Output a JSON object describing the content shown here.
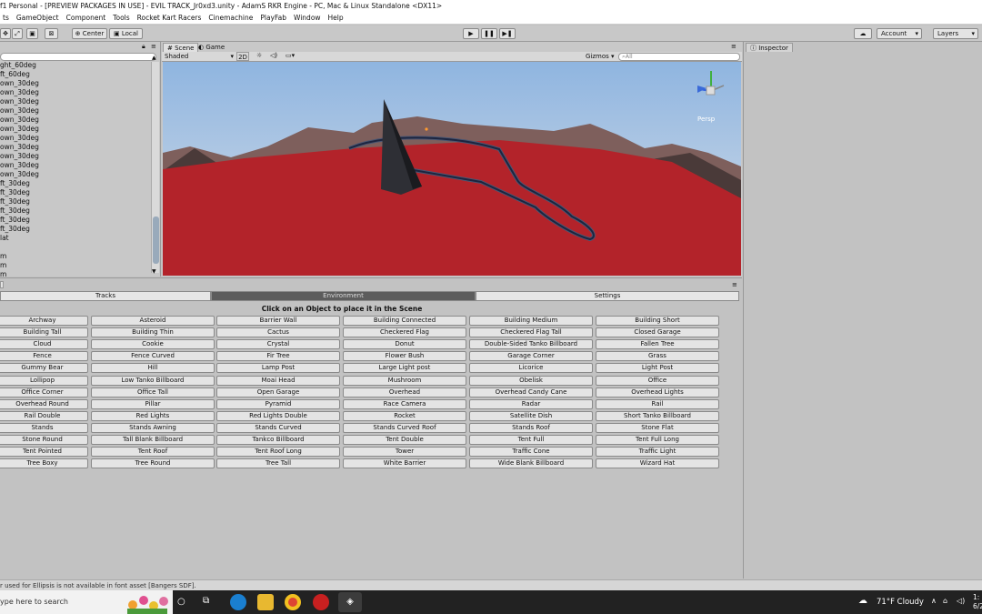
{
  "window_title": "f1 Personal - [PREVIEW PACKAGES IN USE] - EVIL TRACK_Jr0xd3.unity - AdamS RKR Engine - PC, Mac & Linux Standalone <DX11>",
  "menu": [
    "ts",
    "GameObject",
    "Component",
    "Tools",
    "Rocket Kart Racers",
    "Cinemachine",
    "PlayFab",
    "Window",
    "Help"
  ],
  "toolbar": {
    "center": "Center",
    "local": "Local",
    "account": "Account",
    "layers": "Layers"
  },
  "hierarchy_items": [
    "ght_60deg",
    "ft_60deg",
    "own_30deg",
    "own_30deg",
    "own_30deg",
    "own_30deg",
    "own_30deg",
    "own_30deg",
    "own_30deg",
    "own_30deg",
    "own_30deg",
    "own_30deg",
    "own_30deg",
    "ft_30deg",
    "ft_30deg",
    "ft_30deg",
    "ft_30deg",
    "ft_30deg",
    "ft_30deg",
    "lat",
    "",
    "m",
    "m",
    "m"
  ],
  "scene": {
    "tab_scene": "Scene",
    "tab_game": "Game",
    "shaded": "Shaded",
    "twod": "2D",
    "gizmos": "Gizmos",
    "search_placeholder": "All",
    "persp": "Persp"
  },
  "inspector_title": "Inspector",
  "bottom_tabs": [
    "Tracks",
    "Environment",
    "Settings"
  ],
  "hint": "Click on an Object to place it in the Scene",
  "objects": [
    "Archway",
    "Asteroid",
    "Barrier Wall",
    "Building Connected",
    "Building Medium",
    "Building Short",
    "Building Tall",
    "Building Thin",
    "Cactus",
    "Checkered Flag",
    "Checkered Flag Tall",
    "Closed Garage",
    "Cloud",
    "Cookie",
    "Crystal",
    "Donut",
    "Double-Sided Tanko Billboard",
    "Fallen Tree",
    "Fence",
    "Fence Curved",
    "Fir Tree",
    "Flower Bush",
    "Garage Corner",
    "Grass",
    "Gummy Bear",
    "Hill",
    "Lamp Post",
    "Large Light post",
    "Licorice",
    "Light Post",
    "Lollipop",
    "Low Tanko Billboard",
    "Moai Head",
    "Mushroom",
    "Obelisk",
    "Office",
    "Office Corner",
    "Office Tall",
    "Open Garage",
    "Overhead",
    "Overhead Candy Cane",
    "Overhead Lights",
    "Overhead Round",
    "Pillar",
    "Pyramid",
    "Race Camera",
    "Radar",
    "Rail",
    "Rail Double",
    "Red Lights",
    "Red Lights Double",
    "Rocket",
    "Satellite Dish",
    "Short Tanko Billboard",
    "Stands",
    "Stands Awning",
    "Stands Curved",
    "Stands Curved Roof",
    "Stands Roof",
    "Stone Flat",
    "Stone Round",
    "Tall Blank Billboard",
    "Tankco Billboard",
    "Tent Double",
    "Tent Full",
    "Tent Full Long",
    "Tent Pointed",
    "Tent Roof",
    "Tent Roof Long",
    "Tower",
    "Traffic Cone",
    "Traffic Light",
    "Tree Boxy",
    "Tree Round",
    "Tree Tall",
    "White Barrier",
    "Wide Blank Billboard",
    "Wizard Hat"
  ],
  "status_message": "r used for Ellipsis is not available in font asset [Bangers SDF].",
  "taskbar": {
    "search_placeholder": "ype here to search",
    "weather": "71°F  Cloudy",
    "clock_time": "1:",
    "clock_date": "6/2"
  },
  "colors": {
    "ground": "#b3232a",
    "sky": "#aac4e4",
    "selected_tab": "#5c5c5c"
  }
}
